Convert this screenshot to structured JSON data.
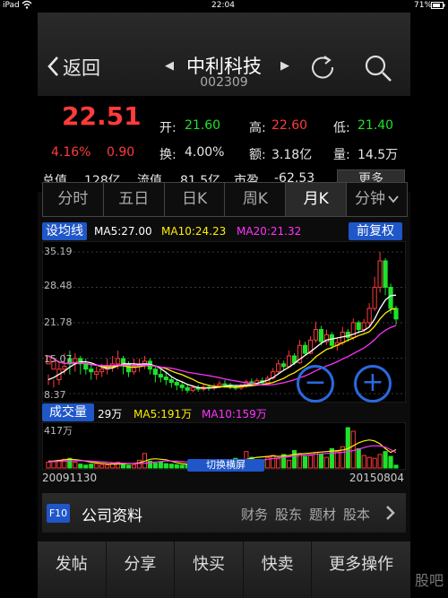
{
  "status_bar": {
    "device": "iPad",
    "time": "22:04",
    "battery": "71%"
  },
  "header": {
    "back_label": "返回",
    "stock_name": "中利科技",
    "stock_code": "002309"
  },
  "quote": {
    "price": "22.51",
    "change_pct": "4.16%",
    "change": "0.90",
    "open_label": "开:",
    "open": "21.60",
    "high_label": "高:",
    "high": "22.60",
    "low_label": "低:",
    "low": "21.40",
    "turnover_label": "换:",
    "turnover": "4.00%",
    "amount_label": "额:",
    "amount": "3.18亿",
    "volume_label": "量:",
    "volume": "14.5万",
    "total_cap_label": "总值",
    "total_cap": "128亿",
    "float_cap_label": "流值",
    "float_cap": "81.5亿",
    "pe_label": "市盈",
    "pe": "-62.53",
    "more_label": "更多"
  },
  "tabs": [
    "分时",
    "五日",
    "日K",
    "周K",
    "月K",
    "分钟"
  ],
  "active_tab": 4,
  "ma": {
    "button": "设均线",
    "ma5": "MA5:27.00",
    "ma10": "MA10:24.23",
    "ma20": "MA20:21.32",
    "restore": "前复权"
  },
  "price_axis": [
    "35.19",
    "28.48",
    "21.78",
    "15.07",
    "8.37"
  ],
  "vol": {
    "button": "成交量",
    "value": "29万",
    "ma5": "MA5:191万",
    "ma10": "MA10:159万",
    "top_label": "417万"
  },
  "switch_label": "切换横屏",
  "dates": {
    "start": "20091130",
    "end": "20150804"
  },
  "f10": {
    "badge": "F10",
    "title": "公司资料",
    "links": [
      "财务",
      "股东",
      "题材",
      "股本"
    ]
  },
  "bottom_bar": [
    "发帖",
    "分享",
    "快买",
    "快卖",
    "更多操作"
  ],
  "watermark": "股吧",
  "colors": {
    "up": "#ff3b3b",
    "down": "#1ee22a",
    "accent": "#1f56c8",
    "ma5": "#ffffff",
    "ma10": "#ffee00",
    "ma20": "#ff33ff"
  },
  "chart_data": {
    "type": "candlestick",
    "period": "monthly",
    "candles": [
      [
        14,
        15.5,
        12,
        10
      ],
      [
        13,
        14.5,
        11,
        9.5
      ],
      [
        11,
        13,
        14.5,
        10
      ],
      [
        13,
        13.5,
        16,
        12
      ],
      [
        15,
        14,
        16.5,
        12
      ],
      [
        14,
        15,
        16,
        12.5
      ],
      [
        15,
        14,
        15.5,
        12
      ],
      [
        14,
        13,
        15,
        12
      ],
      [
        13,
        12.5,
        14,
        11
      ],
      [
        12,
        12.5,
        13.5,
        11
      ],
      [
        12.5,
        13,
        14,
        11.5
      ],
      [
        13,
        13.5,
        15,
        12
      ],
      [
        13.5,
        14,
        15.5,
        12.5
      ],
      [
        14,
        15,
        16.5,
        13
      ],
      [
        15,
        14,
        15.5,
        12
      ],
      [
        14,
        12.5,
        14.5,
        11.5
      ],
      [
        12.5,
        13.5,
        15,
        12
      ],
      [
        13.5,
        14,
        15,
        12.5
      ],
      [
        14,
        14.5,
        15.5,
        13
      ],
      [
        14.5,
        13,
        15,
        12
      ],
      [
        13,
        12,
        13.5,
        10.5
      ],
      [
        12,
        11.5,
        13,
        10.5
      ],
      [
        11.5,
        11,
        12.5,
        10
      ],
      [
        11,
        10.5,
        11.5,
        9.5
      ],
      [
        10.5,
        10,
        11,
        9
      ],
      [
        10,
        9.5,
        10.5,
        8.8
      ],
      [
        9.5,
        9,
        10,
        8.5
      ],
      [
        9,
        9.5,
        10,
        8.6
      ],
      [
        9.5,
        9.2,
        10,
        8.7
      ],
      [
        9.2,
        9.6,
        10,
        8.8
      ],
      [
        9.6,
        9.4,
        10.1,
        8.9
      ],
      [
        9.4,
        9.8,
        10.3,
        9
      ],
      [
        9.8,
        10.2,
        10.8,
        9.4
      ],
      [
        10.2,
        10,
        10.9,
        9.5
      ],
      [
        10,
        9.7,
        10.4,
        9.2
      ],
      [
        9.7,
        9.4,
        10,
        9
      ],
      [
        9.4,
        9.8,
        10.2,
        9.1
      ],
      [
        9.8,
        10.6,
        11,
        9.5
      ],
      [
        10.6,
        10.2,
        11.2,
        9.8
      ],
      [
        10.2,
        10.8,
        11.3,
        10
      ],
      [
        10.8,
        10.4,
        11.4,
        10
      ],
      [
        10.4,
        11.3,
        11.8,
        10.2
      ],
      [
        11.3,
        12.5,
        13.2,
        11
      ],
      [
        12.5,
        14,
        14.8,
        12.2
      ],
      [
        14,
        13.5,
        14.6,
        12.8
      ],
      [
        13.5,
        15.5,
        16.5,
        13.2
      ],
      [
        15.5,
        14.2,
        16,
        13.8
      ],
      [
        14.2,
        17.5,
        18.5,
        14
      ],
      [
        17.5,
        16,
        18.2,
        15.5
      ],
      [
        16,
        18.5,
        19.2,
        15.8
      ],
      [
        18.5,
        20.5,
        22,
        18
      ],
      [
        20.5,
        18.2,
        21.2,
        17.5
      ],
      [
        18.2,
        19.5,
        20.5,
        17.6
      ],
      [
        19.5,
        17.5,
        20,
        16.8
      ],
      [
        17.5,
        18,
        19,
        16.5
      ],
      [
        18,
        20,
        21,
        17.5
      ],
      [
        20,
        19,
        20.6,
        18.2
      ],
      [
        19,
        21.8,
        22.6,
        18.5
      ],
      [
        21.8,
        20.5,
        22.2,
        19.8
      ],
      [
        20.5,
        21.8,
        22.5,
        20
      ],
      [
        21.8,
        24.5,
        25.5,
        21.2
      ],
      [
        24.5,
        28.5,
        30.5,
        24
      ],
      [
        28.5,
        33.5,
        35.2,
        27.5
      ],
      [
        33.5,
        28.5,
        34,
        27
      ],
      [
        28.5,
        24.5,
        29.2,
        23.5
      ],
      [
        24.5,
        22.5,
        25,
        21.4
      ]
    ],
    "candle_format": "open, close, high, low",
    "ylim": [
      8.37,
      35.19
    ],
    "ma5": [
      11,
      11.4,
      12,
      12.6,
      13.4,
      14,
      14.4,
      14.4,
      14.2,
      13.8,
      13.4,
      13.1,
      13.2,
      13.6,
      14,
      14,
      14,
      13.9,
      14,
      13.9,
      13.6,
      13.1,
      12.4,
      11.6,
      11,
      10.6,
      10.1,
      9.8,
      9.5,
      9.4,
      9.4,
      9.5,
      9.6,
      9.8,
      9.9,
      9.9,
      9.9,
      10,
      10.1,
      10.3,
      10.6,
      10.9,
      11.4,
      12.1,
      12.8,
      13.4,
      14.1,
      14.9,
      15.6,
      16.3,
      17.1,
      17.9,
      18.5,
      18.7,
      18.9,
      19.1,
      19.3,
      19.6,
      20,
      20.3,
      21,
      22.5,
      24.5,
      26.1,
      26.9,
      27
    ]
  },
  "volume_data": {
    "unit": "万",
    "top_label": 417,
    "values": [
      60,
      70,
      80,
      90,
      100,
      60,
      40,
      30,
      40,
      45,
      35,
      30,
      45,
      60,
      40,
      30,
      35,
      80,
      150,
      70,
      50,
      60,
      45,
      40,
      35,
      30,
      35,
      40,
      45,
      50,
      60,
      70,
      80,
      55,
      60,
      100,
      65,
      170,
      110,
      70,
      80,
      110,
      130,
      95,
      140,
      80,
      180,
      150,
      120,
      130,
      160,
      140,
      110,
      200,
      170,
      220,
      417,
      380,
      200,
      130,
      110,
      100,
      140,
      170,
      120,
      29
    ],
    "ma5": [
      70,
      72,
      78,
      85,
      90,
      86,
      80,
      70,
      60,
      55,
      48,
      42,
      40,
      42,
      44,
      46,
      48,
      55,
      70,
      90,
      95,
      90,
      85,
      70,
      55,
      45,
      40,
      38,
      40,
      42,
      45,
      50,
      55,
      60,
      65,
      70,
      75,
      90,
      100,
      110,
      115,
      120,
      125,
      120,
      125,
      130,
      140,
      145,
      150,
      155,
      160,
      165,
      170,
      175,
      180,
      185,
      200,
      230,
      260,
      280,
      290,
      280,
      250,
      200,
      160,
      191
    ],
    "ma10": [
      65,
      66,
      68,
      70,
      72,
      74,
      76,
      74,
      72,
      68,
      64,
      60,
      56,
      52,
      50,
      48,
      46,
      46,
      50,
      55,
      62,
      68,
      72,
      72,
      70,
      66,
      62,
      58,
      55,
      52,
      50,
      50,
      52,
      54,
      56,
      58,
      60,
      64,
      70,
      76,
      82,
      90,
      98,
      104,
      110,
      116,
      122,
      128,
      134,
      138,
      142,
      146,
      150,
      154,
      158,
      162,
      170,
      180,
      195,
      210,
      225,
      230,
      228,
      215,
      190,
      159
    ]
  }
}
